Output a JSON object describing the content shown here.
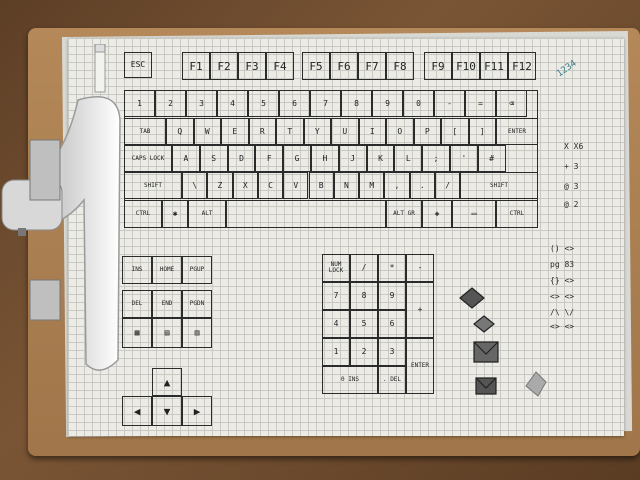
{
  "photo": {
    "description_free": true,
    "function_row": [
      "ESC",
      "F1",
      "F2",
      "F3",
      "F4",
      "F5",
      "F6",
      "F7",
      "F8",
      "F9",
      "F10",
      "F11",
      "F12"
    ],
    "bottom_row": {
      "ctrl_left": "CTRL",
      "alt_left": "ALT",
      "alt_right": "ALT GR",
      "ctrl_right": "CTRL"
    },
    "modifiers": {
      "tab": "TAB",
      "caps": "CAPS LOCK",
      "shift_left": "SHIFT",
      "shift_right": "SHIFT",
      "enter": "ENTER"
    },
    "nav_cluster": [
      "INS",
      "HOME",
      "PGUP",
      "DEL",
      "END",
      "PGDN"
    ],
    "numpad_top": [
      "NUM LOCK",
      "/",
      "*",
      "-"
    ],
    "numpad_zero": "0 INS",
    "numpad_dot": ". DEL",
    "numpad_enter": "ENTER",
    "numpad_digits": [
      "7",
      "8",
      "9",
      "4",
      "5",
      "6",
      "1",
      "2",
      "3"
    ],
    "legend_right": [
      "X  X6",
      "+  3",
      "@  3",
      "@  2"
    ],
    "legend_brackets": [
      "() <>",
      "pg  83",
      "{} <>",
      "<> <>",
      "/\\ \\/",
      "<>  <>"
    ],
    "corner_note": "1234"
  }
}
